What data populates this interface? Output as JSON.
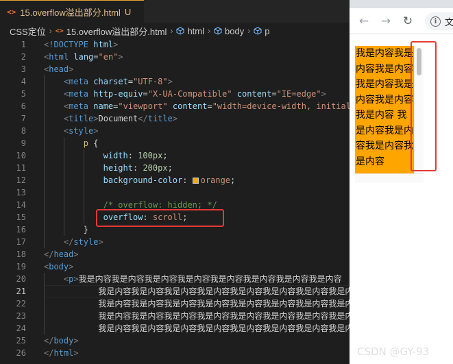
{
  "editor": {
    "tab": {
      "icon": "<>",
      "label": "15.overflow溢出部分.html",
      "status": "U"
    },
    "breadcrumb": {
      "items": [
        {
          "label": "CSS定位"
        },
        {
          "label": "15.overflow溢出部分.html",
          "icon": "html-file-icon"
        },
        {
          "label": "html",
          "icon": "element-cube-icon"
        },
        {
          "label": "body",
          "icon": "element-cube-icon"
        },
        {
          "label": "p",
          "icon": "element-cube-icon"
        }
      ]
    },
    "current_line": 21,
    "lines": [
      {
        "n": "1",
        "indent": 0,
        "tokens": [
          [
            "tg",
            "<"
          ],
          [
            "kw",
            "!DOCTYPE"
          ],
          [
            "tx",
            " "
          ],
          [
            "at",
            "html"
          ],
          [
            "tg",
            ">"
          ]
        ]
      },
      {
        "n": "2",
        "indent": 0,
        "tokens": [
          [
            "tg",
            "<"
          ],
          [
            "kw",
            "html"
          ],
          [
            "tx",
            " "
          ],
          [
            "at",
            "lang"
          ],
          [
            "tx",
            "="
          ],
          [
            "st",
            "\"en\""
          ],
          [
            "tg",
            ">"
          ]
        ]
      },
      {
        "n": "3",
        "indent": 0,
        "tokens": [
          [
            "tg",
            "<"
          ],
          [
            "kw",
            "head"
          ],
          [
            "tg",
            ">"
          ]
        ]
      },
      {
        "n": "4",
        "indent": 1,
        "tokens": [
          [
            "tg",
            "<"
          ],
          [
            "kw",
            "meta"
          ],
          [
            "tx",
            " "
          ],
          [
            "at",
            "charset"
          ],
          [
            "tx",
            "="
          ],
          [
            "st",
            "\"UTF-8\""
          ],
          [
            "tg",
            ">"
          ]
        ]
      },
      {
        "n": "5",
        "indent": 1,
        "tokens": [
          [
            "tg",
            "<"
          ],
          [
            "kw",
            "meta"
          ],
          [
            "tx",
            " "
          ],
          [
            "at",
            "http-equiv"
          ],
          [
            "tx",
            "="
          ],
          [
            "st",
            "\"X-UA-Compatible\""
          ],
          [
            "tx",
            " "
          ],
          [
            "at",
            "content"
          ],
          [
            "tx",
            "="
          ],
          [
            "st",
            "\"IE=edge\""
          ],
          [
            "tg",
            ">"
          ]
        ]
      },
      {
        "n": "6",
        "indent": 1,
        "tokens": [
          [
            "tg",
            "<"
          ],
          [
            "kw",
            "meta"
          ],
          [
            "tx",
            " "
          ],
          [
            "at",
            "name"
          ],
          [
            "tx",
            "="
          ],
          [
            "st",
            "\"viewport\""
          ],
          [
            "tx",
            " "
          ],
          [
            "at",
            "content"
          ],
          [
            "tx",
            "="
          ],
          [
            "st",
            "\"width=device-width, initial"
          ]
        ]
      },
      {
        "n": "7",
        "indent": 1,
        "tokens": [
          [
            "tg",
            "<"
          ],
          [
            "kw",
            "title"
          ],
          [
            "tg",
            ">"
          ],
          [
            "tx",
            "Document"
          ],
          [
            "tg",
            "</"
          ],
          [
            "kw",
            "title"
          ],
          [
            "tg",
            ">"
          ]
        ]
      },
      {
        "n": "8",
        "indent": 1,
        "tokens": [
          [
            "tg",
            "<"
          ],
          [
            "kw",
            "style"
          ],
          [
            "tg",
            ">"
          ]
        ]
      },
      {
        "n": "9",
        "indent": 2,
        "tokens": [
          [
            "se",
            "p"
          ],
          [
            "tx",
            " {"
          ]
        ]
      },
      {
        "n": "10",
        "indent": 3,
        "tokens": [
          [
            "pr",
            "width"
          ],
          [
            "tx",
            ": "
          ],
          [
            "nu",
            "100px"
          ],
          [
            "tx",
            ";"
          ]
        ]
      },
      {
        "n": "11",
        "indent": 3,
        "tokens": [
          [
            "pr",
            "height"
          ],
          [
            "tx",
            ": "
          ],
          [
            "nu",
            "200px"
          ],
          [
            "tx",
            ";"
          ]
        ]
      },
      {
        "n": "12",
        "indent": 3,
        "tokens": [
          [
            "pr",
            "background-color"
          ],
          [
            "tx",
            ": "
          ],
          [
            "swatch",
            ""
          ],
          [
            "vl",
            "orange"
          ],
          [
            "tx",
            ";"
          ]
        ]
      },
      {
        "n": "13",
        "indent": 3,
        "tokens": []
      },
      {
        "n": "14",
        "indent": 3,
        "tokens": [
          [
            "cm",
            "/* overflow: hidden; */"
          ]
        ]
      },
      {
        "n": "15",
        "indent": 3,
        "tokens": [
          [
            "pr",
            "overflow"
          ],
          [
            "tx",
            ": "
          ],
          [
            "vl",
            "scroll"
          ],
          [
            "tx",
            ";"
          ]
        ]
      },
      {
        "n": "16",
        "indent": 2,
        "tokens": [
          [
            "tx",
            "}"
          ]
        ]
      },
      {
        "n": "17",
        "indent": 1,
        "tokens": [
          [
            "tg",
            "</"
          ],
          [
            "kw",
            "style"
          ],
          [
            "tg",
            ">"
          ]
        ]
      },
      {
        "n": "18",
        "indent": 0,
        "tokens": [
          [
            "tg",
            "</"
          ],
          [
            "kw",
            "head"
          ],
          [
            "tg",
            ">"
          ]
        ]
      },
      {
        "n": "19",
        "indent": 0,
        "tokens": [
          [
            "tg",
            "<"
          ],
          [
            "kw",
            "body"
          ],
          [
            "tg",
            ">"
          ]
        ]
      },
      {
        "n": "20",
        "indent": 1,
        "tokens": [
          [
            "tg",
            "<"
          ],
          [
            "kw",
            "p"
          ],
          [
            "tg",
            ">"
          ],
          [
            "cjk",
            "我是内容我是内容我是内容我是内容我是内容我是内容我是内容我是内容"
          ]
        ]
      },
      {
        "n": "21",
        "indent": 1,
        "pad": 7,
        "tokens": [
          [
            "cjk",
            "我是内容我是内容我是内容我是内容我是内容我是内容我是内容我是内容"
          ]
        ]
      },
      {
        "n": "22",
        "indent": 1,
        "pad": 7,
        "tokens": [
          [
            "cjk",
            "我是内容我是内容我是内容我是内容我是内容我是内容我是内容我是内容"
          ]
        ]
      },
      {
        "n": "23",
        "indent": 1,
        "pad": 7,
        "tokens": [
          [
            "cjk",
            "我是内容我是内容我是内容我是内容我是内容我是内容我是内容我是内容"
          ]
        ]
      },
      {
        "n": "24",
        "indent": 1,
        "pad": 7,
        "tokens": [
          [
            "cjk",
            "我是内容我是内容我是内容我是内容我是内容我是内容我是内容我是内容"
          ],
          [
            "tg",
            "<"
          ]
        ]
      },
      {
        "n": "25",
        "indent": 0,
        "tokens": [
          [
            "tg",
            "</"
          ],
          [
            "kw",
            "body"
          ],
          [
            "tg",
            ">"
          ]
        ]
      },
      {
        "n": "26",
        "indent": 0,
        "tokens": [
          [
            "tg",
            "</"
          ],
          [
            "kw",
            "html"
          ],
          [
            "tg",
            ">"
          ]
        ]
      }
    ]
  },
  "browser": {
    "back_icon": "←",
    "forward_icon": "→",
    "reload_icon": "↻",
    "info_icon": "i",
    "url_text": "文",
    "paragraph_text": "我是内容我是内容我是内容我是内容我是内容我是内容我是内容 我是内容我是内容我是内容我是内容"
  },
  "colors": {
    "editor_bg": "#1e1e1e",
    "tab_accent": "#e8a23a",
    "highlight_red": "#e53935",
    "paragraph_bg": "#ffa500"
  },
  "watermark": "CSDN @GY-93"
}
